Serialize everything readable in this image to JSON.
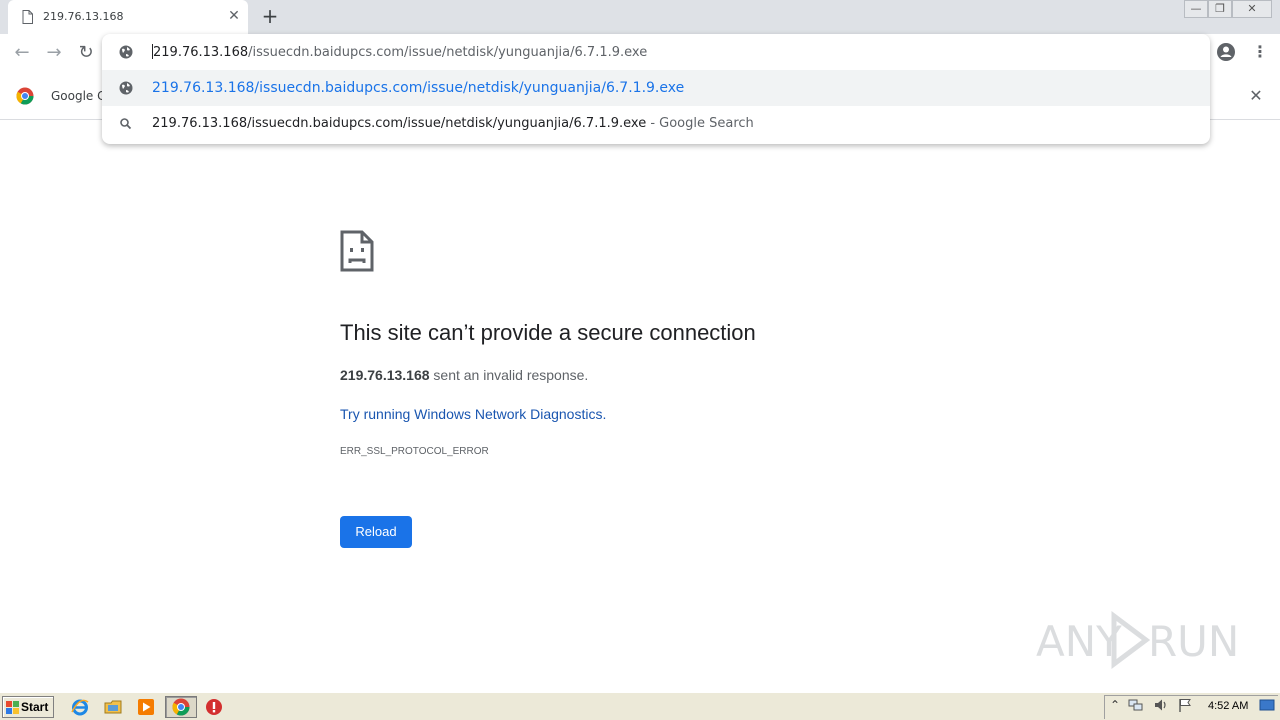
{
  "tab": {
    "title": "219.76.13.168"
  },
  "window_controls": {
    "minimize": "—",
    "restore": "❐",
    "close": "✕"
  },
  "toolbar": {
    "back": "←",
    "forward": "→",
    "reload": "↻",
    "menu": "⋮"
  },
  "omnibox": {
    "input_host": "219.76.13.168",
    "input_path": "/issuecdn.baidupcs.com/issue/netdisk/yunguanjia/6.7.1.9.exe",
    "suggestion_url": "219.76.13.168/issuecdn.baidupcs.com/issue/netdisk/yunguanjia/6.7.1.9.exe",
    "suggestion_search": "219.76.13.168/issuecdn.baidupcs.com/issue/netdisk/yunguanjia/6.7.1.9.exe",
    "suggestion_search_suffix": " - Google Search"
  },
  "bookmarks": {
    "item_label": "Google Cl",
    "close": "✕"
  },
  "error": {
    "title": "This site can’t provide a secure connection",
    "host": "219.76.13.168",
    "desc_suffix": " sent an invalid response.",
    "link": "Try running Windows Network Diagnostics.",
    "code": "ERR_SSL_PROTOCOL_ERROR",
    "reload": "Reload"
  },
  "watermark": {
    "text": "ANY RUN"
  },
  "taskbar": {
    "start": "Start",
    "clock": "4:52 AM"
  },
  "colors": {
    "accent": "#1a73e8",
    "link": "#1a56b0",
    "tabstrip": "#dee1e6"
  }
}
